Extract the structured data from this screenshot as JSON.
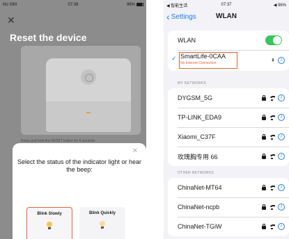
{
  "left_screen": {
    "status": {
      "carrier": "No SIM",
      "time": "07:36",
      "battery": "96%"
    },
    "title": "Reset the device",
    "instruction_peek": "Press and hold the RESET button for 5 seconds",
    "sheet": {
      "prompt": "Select the status of the indicator light or hear the beep:",
      "options": [
        {
          "label": "Blink Slowly",
          "selected": true
        },
        {
          "label": "Blink Quickly",
          "selected": false
        }
      ]
    },
    "accent_color": "#e8632a"
  },
  "right_screen": {
    "status": {
      "carrier": "◀ 智能生活",
      "time": "07:37",
      "battery": "◀ 96%"
    },
    "nav": {
      "back_label": "Settings",
      "title": "WLAN"
    },
    "wlan_row": {
      "label": "WLAN",
      "enabled": true
    },
    "current_network": {
      "name": "SmartLife-0CAA",
      "status": "No Internet Connection"
    },
    "my_networks_header": "MY NETWORKS",
    "my_networks": [
      "DYGSM_5G",
      "TP-LINK_EDA9",
      "Xiaomi_C37F",
      "玫瑰胸专用 66"
    ],
    "other_networks_header": "OTHER NETWORKS",
    "other_networks": [
      "ChinaNet-MT64",
      "ChinaNet-ncpb",
      "ChinaNet-TGiW"
    ],
    "toggle_color": "#34c759",
    "link_color": "#1a7cf3"
  }
}
